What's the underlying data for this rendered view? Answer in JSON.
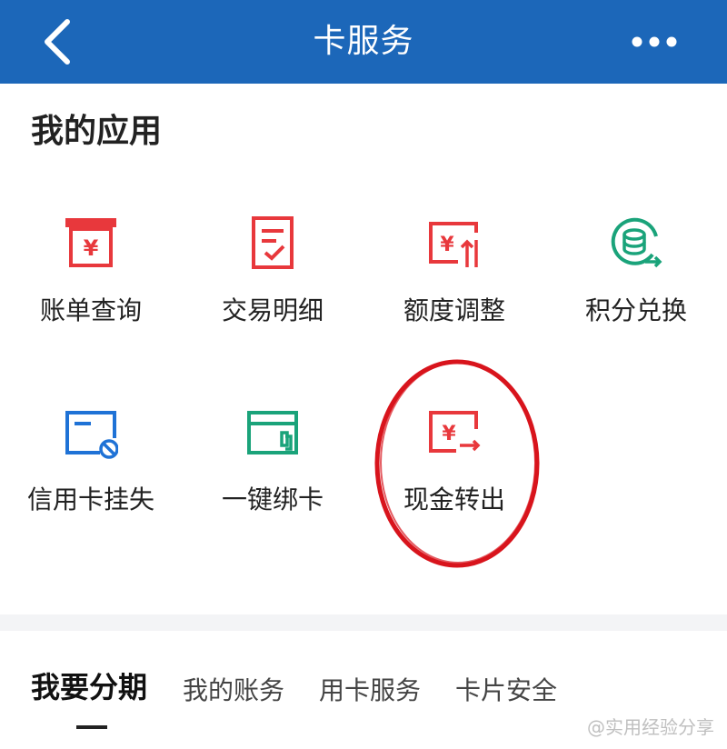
{
  "header": {
    "title": "卡服务",
    "back_icon": "chevron-left-icon",
    "more_icon": "more-dots-icon",
    "bg_color": "#1c67b9"
  },
  "my_apps": {
    "title": "我的应用",
    "items": [
      {
        "label": "账单查询",
        "icon": "bill-inquiry-icon",
        "color": "#e8383c"
      },
      {
        "label": "交易明细",
        "icon": "transaction-detail-icon",
        "color": "#e8383c"
      },
      {
        "label": "额度调整",
        "icon": "limit-adjust-icon",
        "color": "#e8383c"
      },
      {
        "label": "积分兑换",
        "icon": "points-exchange-icon",
        "color": "#1aa37a"
      },
      {
        "label": "信用卡挂失",
        "icon": "card-report-loss-icon",
        "color": "#1f72d6"
      },
      {
        "label": "一键绑卡",
        "icon": "bind-card-icon",
        "color": "#1aa37a"
      },
      {
        "label": "现金转出",
        "icon": "cash-transfer-icon",
        "color": "#e8383c"
      }
    ]
  },
  "tabs": {
    "items": [
      "我要分期",
      "我的账务",
      "用卡服务",
      "卡片安全"
    ],
    "active_index": 0
  },
  "watermark": "@实用经验分享",
  "annotation": {
    "highlight_color": "#d8141c"
  }
}
